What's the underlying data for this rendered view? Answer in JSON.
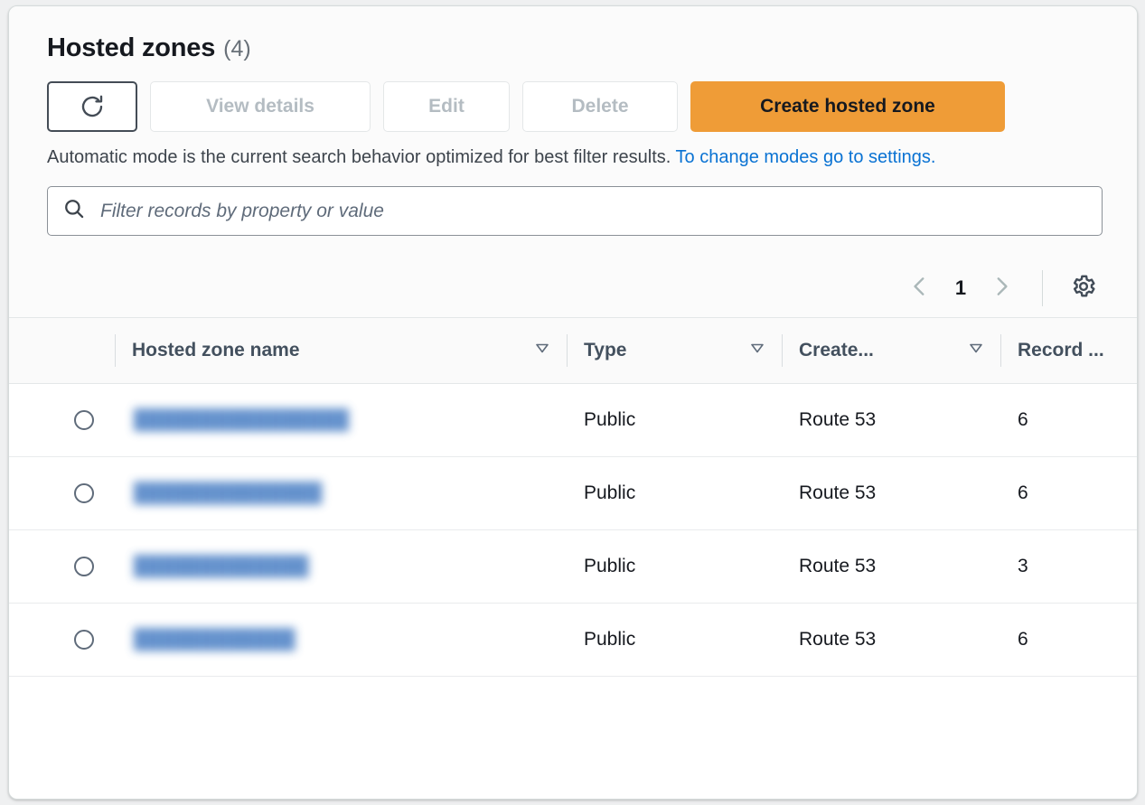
{
  "header": {
    "title": "Hosted zones",
    "count": "(4)"
  },
  "toolbar": {
    "refresh_icon": "refresh-icon",
    "view_details_label": "View details",
    "edit_label": "Edit",
    "delete_label": "Delete",
    "create_label": "Create hosted zone",
    "primary_color": "#ef9c37"
  },
  "info": {
    "text": "Automatic mode is the current search behavior optimized for best filter results.",
    "link_text": "To change modes go to settings.",
    "link_color": "#0972d3"
  },
  "search": {
    "icon": "search-icon",
    "placeholder": "Filter records by property or value",
    "value": ""
  },
  "pagination": {
    "prev_icon": "chevron-left-icon",
    "page": "1",
    "next_icon": "chevron-right-icon",
    "settings_icon": "gear-icon"
  },
  "table": {
    "columns": [
      {
        "label": "",
        "name": "select"
      },
      {
        "label": "Hosted zone name",
        "name": "hosted-zone-name",
        "sort_icon": "sort-descending-icon"
      },
      {
        "label": "Type",
        "name": "type",
        "sort_icon": "sort-descending-icon"
      },
      {
        "label": "Create...",
        "name": "created-by",
        "sort_icon": "sort-descending-icon"
      },
      {
        "label": "Record ...",
        "name": "record-count"
      }
    ],
    "rows": [
      {
        "selected": false,
        "name": "████████████████",
        "name_redacted": true,
        "type": "Public",
        "created_by": "Route 53",
        "record_count": "6"
      },
      {
        "selected": false,
        "name": "██████████████",
        "name_redacted": true,
        "type": "Public",
        "created_by": "Route 53",
        "record_count": "6"
      },
      {
        "selected": false,
        "name": "█████████████",
        "name_redacted": true,
        "type": "Public",
        "created_by": "Route 53",
        "record_count": "3"
      },
      {
        "selected": false,
        "name": "████████████",
        "name_redacted": true,
        "type": "Public",
        "created_by": "Route 53",
        "record_count": "6"
      }
    ]
  }
}
